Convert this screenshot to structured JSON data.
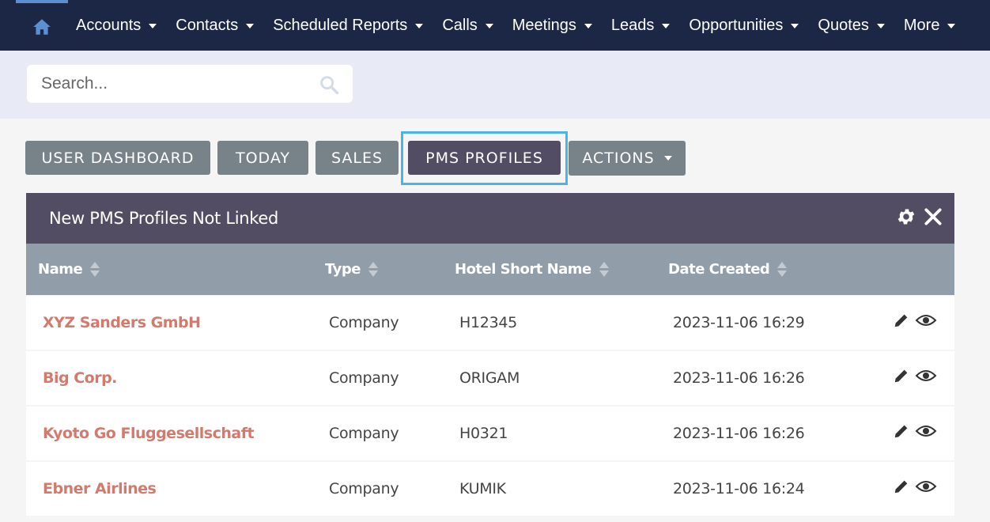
{
  "nav": {
    "items": [
      {
        "label": "Accounts"
      },
      {
        "label": "Contacts"
      },
      {
        "label": "Scheduled Reports"
      },
      {
        "label": "Calls"
      },
      {
        "label": "Meetings"
      },
      {
        "label": "Leads"
      },
      {
        "label": "Opportunities"
      },
      {
        "label": "Quotes"
      },
      {
        "label": "More"
      }
    ],
    "home_icon": "home-icon"
  },
  "search": {
    "placeholder": "Search...",
    "icon": "search-icon"
  },
  "tabs": [
    {
      "label": "USER DASHBOARD"
    },
    {
      "label": "TODAY"
    },
    {
      "label": "SALES"
    },
    {
      "label": "PMS PROFILES"
    },
    {
      "label": "ACTIONS"
    }
  ],
  "dashlet": {
    "title": "New PMS Profiles Not Linked",
    "columns": [
      {
        "label": "Name"
      },
      {
        "label": "Type"
      },
      {
        "label": "Hotel Short Name"
      },
      {
        "label": "Date Created"
      }
    ],
    "rows": [
      {
        "name": "XYZ Sanders GmbH",
        "type": "Company",
        "hotel": "H12345",
        "date": "2023-11-06 16:29"
      },
      {
        "name": "Big Corp.",
        "type": "Company",
        "hotel": "ORIGAM",
        "date": "2023-11-06 16:26"
      },
      {
        "name": "Kyoto Go Fluggesellschaft",
        "type": "Company",
        "hotel": "H0321",
        "date": "2023-11-06 16:26"
      },
      {
        "name": "Ebner Airlines",
        "type": "Company",
        "hotel": "KUMIK",
        "date": "2023-11-06 16:24"
      }
    ]
  },
  "colors": {
    "nav_bg": "#1c2745",
    "dashlet_head": "#534d64",
    "table_head": "#929daa",
    "link": "#d37a6c",
    "tab_bg": "#778289",
    "highlight": "#4ab3e8"
  }
}
